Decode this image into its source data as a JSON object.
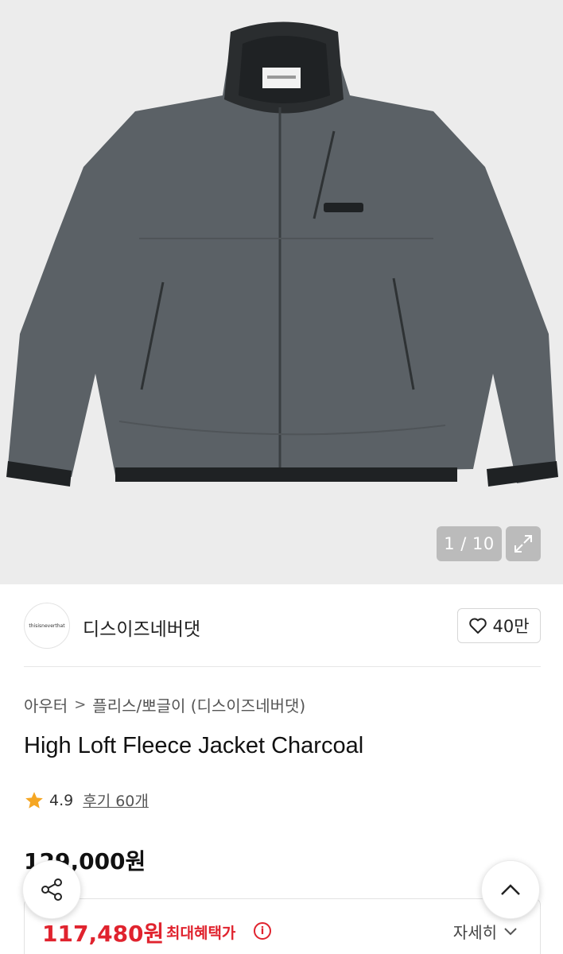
{
  "gallery": {
    "counter": "1 / 10",
    "expand_icon": "expand-icon",
    "jacket_colors": {
      "body": "#5b6166",
      "trim": "#1f2224"
    }
  },
  "brand": {
    "logo_text": "thisisneverthat",
    "name": "디스이즈네버댓",
    "likes": "40만",
    "like_icon": "heart-icon"
  },
  "breadcrumb": {
    "items": [
      "아우터",
      "플리스/뽀글이 (디스이즈네버댓)"
    ],
    "separator": ">"
  },
  "product": {
    "title": "High Loft Fleece Jacket Charcoal",
    "rating": "4.9",
    "reviews": "후기 60개",
    "price": "129,000원"
  },
  "benefit": {
    "price": "117,480원",
    "label": "최대혜택가",
    "info_symbol": "i",
    "detail_label": "자세히"
  },
  "colors": {
    "accent_red": "#e0232e",
    "star": "#f5a623"
  }
}
